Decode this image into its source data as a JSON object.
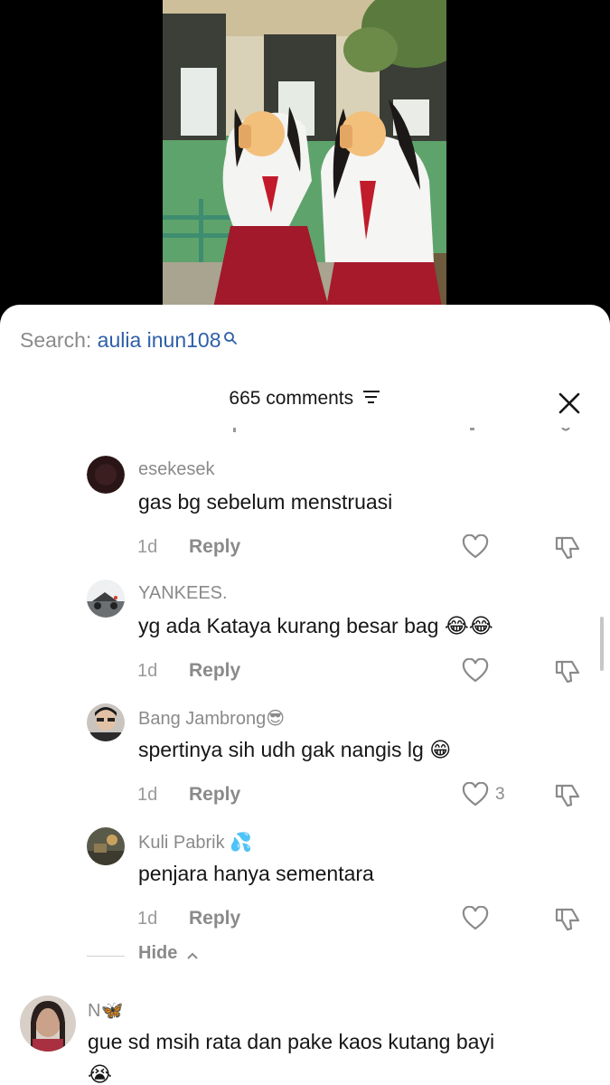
{
  "search": {
    "prefix": "Search: ",
    "query": "aulia inun108"
  },
  "comments_header": {
    "count_label": "665 comments"
  },
  "comments": [
    {
      "username": "esekesek",
      "text": "gas bg sebelum menstruasi",
      "time": "1d",
      "reply": "Reply"
    },
    {
      "username": "YANKEES.",
      "text": "yg ada Kataya kurang besar bag",
      "emoji": "😂😂",
      "time": "1d",
      "reply": "Reply"
    },
    {
      "username": "Bang Jambrong",
      "username_emoji": "😎",
      "text": "spertinya sih udh gak nangis lg",
      "emoji": "😁",
      "time": "1d",
      "reply": "Reply",
      "likes": "3"
    },
    {
      "username": "Kuli Pabrik",
      "username_emoji": "💦",
      "text": "penjara hanya sementara",
      "time": "1d",
      "reply": "Reply"
    }
  ],
  "hide_label": "Hide",
  "next_comment": {
    "username": "N",
    "username_emoji": "🦋",
    "text": "gue sd msih rata dan pake kaos kutang bayi",
    "emoji": "😭"
  },
  "colors": {
    "search_query": "#2e5fa8",
    "muted_text": "#8a8a8a",
    "primary_text": "#161616",
    "sheet_bg": "#ffffff"
  }
}
